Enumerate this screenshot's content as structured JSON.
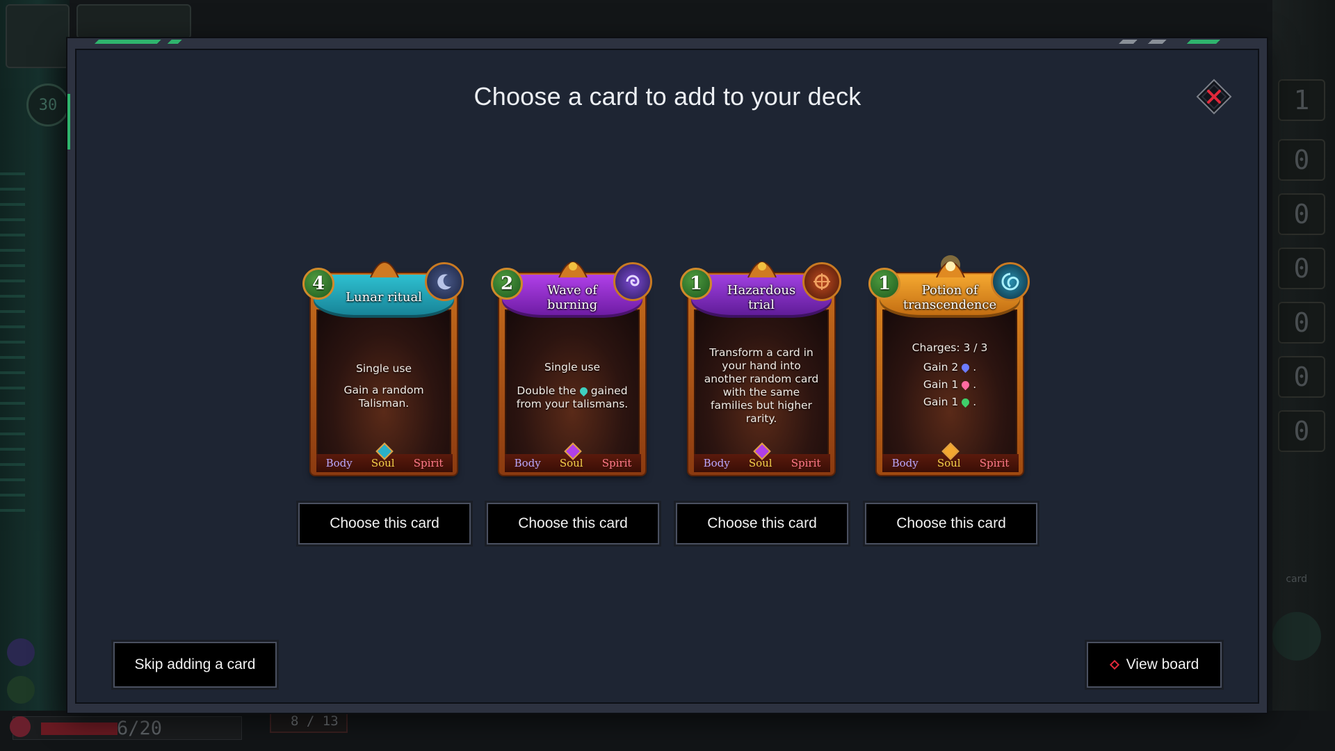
{
  "modal": {
    "title": "Choose a card to add to your deck"
  },
  "cards": [
    {
      "cost": "4",
      "name_lines": [
        "Lunar ritual"
      ],
      "text": [
        "Single use",
        "",
        "Gain a random",
        "Talisman."
      ],
      "banner_color": "#1ea3b5",
      "emblem_color": "#2b3a66",
      "footer": [
        "Body",
        "Soul",
        "Spirit"
      ],
      "choose_label": "Choose this card"
    },
    {
      "cost": "2",
      "name_lines": [
        "Wave of",
        "burning"
      ],
      "text": [
        "Single use",
        "",
        "Double the",
        "gained",
        "from your talismans."
      ],
      "banner_color": "#9b2bd4",
      "emblem_color": "#4a2a8a",
      "footer": [
        "Body",
        "Soul",
        "Spirit"
      ],
      "choose_label": "Choose this card"
    },
    {
      "cost": "1",
      "name_lines": [
        "Hazardous",
        "trial"
      ],
      "text": [
        "Transform a card in",
        "your hand into",
        "another random card",
        "with the same",
        "families but higher",
        "rarity."
      ],
      "banner_color": "#8a2ac6",
      "emblem_color": "#7a2c18",
      "footer": [
        "Body",
        "Soul",
        "Spirit"
      ],
      "choose_label": "Choose this card"
    },
    {
      "cost": "1",
      "name_lines": [
        "Potion of",
        "transcendence"
      ],
      "text": [
        "Charges: 3 / 3",
        "Gain 2",
        "Gain 1",
        "Gain 1"
      ],
      "banner_color": "#e8941e",
      "emblem_color": "#17506a",
      "footer": [
        "Body",
        "Soul",
        "Spirit"
      ],
      "choose_label": "Choose this card"
    }
  ],
  "actions": {
    "skip_label": "Skip adding a card",
    "view_board_label": "View board"
  },
  "background": {
    "turn_counter": "30",
    "health": "6/20",
    "deck": "8 / 13",
    "counters": [
      "1",
      "0",
      "0",
      "0",
      "0",
      "0",
      "0"
    ],
    "card_label": "card"
  },
  "colors": {
    "modal_bg": "#1e2533",
    "accent_green": "#2fb46d",
    "close_red": "#e0283a",
    "gem_blue": "#6c7cff",
    "gem_pink": "#ff6aa0",
    "gem_green": "#3fcf6a",
    "gem_teal": "#3fd0c0"
  },
  "icons": {
    "close": "close-x-diamond-icon",
    "view_board": "red-diamond-icon"
  }
}
